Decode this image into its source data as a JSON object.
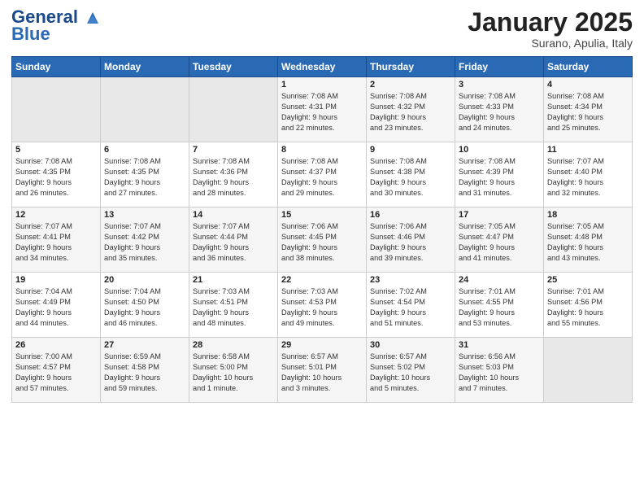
{
  "header": {
    "logo_line1": "General",
    "logo_line2": "Blue",
    "month": "January 2025",
    "location": "Surano, Apulia, Italy"
  },
  "weekdays": [
    "Sunday",
    "Monday",
    "Tuesday",
    "Wednesday",
    "Thursday",
    "Friday",
    "Saturday"
  ],
  "weeks": [
    [
      {
        "num": "",
        "info": ""
      },
      {
        "num": "",
        "info": ""
      },
      {
        "num": "",
        "info": ""
      },
      {
        "num": "1",
        "info": "Sunrise: 7:08 AM\nSunset: 4:31 PM\nDaylight: 9 hours\nand 22 minutes."
      },
      {
        "num": "2",
        "info": "Sunrise: 7:08 AM\nSunset: 4:32 PM\nDaylight: 9 hours\nand 23 minutes."
      },
      {
        "num": "3",
        "info": "Sunrise: 7:08 AM\nSunset: 4:33 PM\nDaylight: 9 hours\nand 24 minutes."
      },
      {
        "num": "4",
        "info": "Sunrise: 7:08 AM\nSunset: 4:34 PM\nDaylight: 9 hours\nand 25 minutes."
      }
    ],
    [
      {
        "num": "5",
        "info": "Sunrise: 7:08 AM\nSunset: 4:35 PM\nDaylight: 9 hours\nand 26 minutes."
      },
      {
        "num": "6",
        "info": "Sunrise: 7:08 AM\nSunset: 4:35 PM\nDaylight: 9 hours\nand 27 minutes."
      },
      {
        "num": "7",
        "info": "Sunrise: 7:08 AM\nSunset: 4:36 PM\nDaylight: 9 hours\nand 28 minutes."
      },
      {
        "num": "8",
        "info": "Sunrise: 7:08 AM\nSunset: 4:37 PM\nDaylight: 9 hours\nand 29 minutes."
      },
      {
        "num": "9",
        "info": "Sunrise: 7:08 AM\nSunset: 4:38 PM\nDaylight: 9 hours\nand 30 minutes."
      },
      {
        "num": "10",
        "info": "Sunrise: 7:08 AM\nSunset: 4:39 PM\nDaylight: 9 hours\nand 31 minutes."
      },
      {
        "num": "11",
        "info": "Sunrise: 7:07 AM\nSunset: 4:40 PM\nDaylight: 9 hours\nand 32 minutes."
      }
    ],
    [
      {
        "num": "12",
        "info": "Sunrise: 7:07 AM\nSunset: 4:41 PM\nDaylight: 9 hours\nand 34 minutes."
      },
      {
        "num": "13",
        "info": "Sunrise: 7:07 AM\nSunset: 4:42 PM\nDaylight: 9 hours\nand 35 minutes."
      },
      {
        "num": "14",
        "info": "Sunrise: 7:07 AM\nSunset: 4:44 PM\nDaylight: 9 hours\nand 36 minutes."
      },
      {
        "num": "15",
        "info": "Sunrise: 7:06 AM\nSunset: 4:45 PM\nDaylight: 9 hours\nand 38 minutes."
      },
      {
        "num": "16",
        "info": "Sunrise: 7:06 AM\nSunset: 4:46 PM\nDaylight: 9 hours\nand 39 minutes."
      },
      {
        "num": "17",
        "info": "Sunrise: 7:05 AM\nSunset: 4:47 PM\nDaylight: 9 hours\nand 41 minutes."
      },
      {
        "num": "18",
        "info": "Sunrise: 7:05 AM\nSunset: 4:48 PM\nDaylight: 9 hours\nand 43 minutes."
      }
    ],
    [
      {
        "num": "19",
        "info": "Sunrise: 7:04 AM\nSunset: 4:49 PM\nDaylight: 9 hours\nand 44 minutes."
      },
      {
        "num": "20",
        "info": "Sunrise: 7:04 AM\nSunset: 4:50 PM\nDaylight: 9 hours\nand 46 minutes."
      },
      {
        "num": "21",
        "info": "Sunrise: 7:03 AM\nSunset: 4:51 PM\nDaylight: 9 hours\nand 48 minutes."
      },
      {
        "num": "22",
        "info": "Sunrise: 7:03 AM\nSunset: 4:53 PM\nDaylight: 9 hours\nand 49 minutes."
      },
      {
        "num": "23",
        "info": "Sunrise: 7:02 AM\nSunset: 4:54 PM\nDaylight: 9 hours\nand 51 minutes."
      },
      {
        "num": "24",
        "info": "Sunrise: 7:01 AM\nSunset: 4:55 PM\nDaylight: 9 hours\nand 53 minutes."
      },
      {
        "num": "25",
        "info": "Sunrise: 7:01 AM\nSunset: 4:56 PM\nDaylight: 9 hours\nand 55 minutes."
      }
    ],
    [
      {
        "num": "26",
        "info": "Sunrise: 7:00 AM\nSunset: 4:57 PM\nDaylight: 9 hours\nand 57 minutes."
      },
      {
        "num": "27",
        "info": "Sunrise: 6:59 AM\nSunset: 4:58 PM\nDaylight: 9 hours\nand 59 minutes."
      },
      {
        "num": "28",
        "info": "Sunrise: 6:58 AM\nSunset: 5:00 PM\nDaylight: 10 hours\nand 1 minute."
      },
      {
        "num": "29",
        "info": "Sunrise: 6:57 AM\nSunset: 5:01 PM\nDaylight: 10 hours\nand 3 minutes."
      },
      {
        "num": "30",
        "info": "Sunrise: 6:57 AM\nSunset: 5:02 PM\nDaylight: 10 hours\nand 5 minutes."
      },
      {
        "num": "31",
        "info": "Sunrise: 6:56 AM\nSunset: 5:03 PM\nDaylight: 10 hours\nand 7 minutes."
      },
      {
        "num": "",
        "info": ""
      }
    ]
  ]
}
